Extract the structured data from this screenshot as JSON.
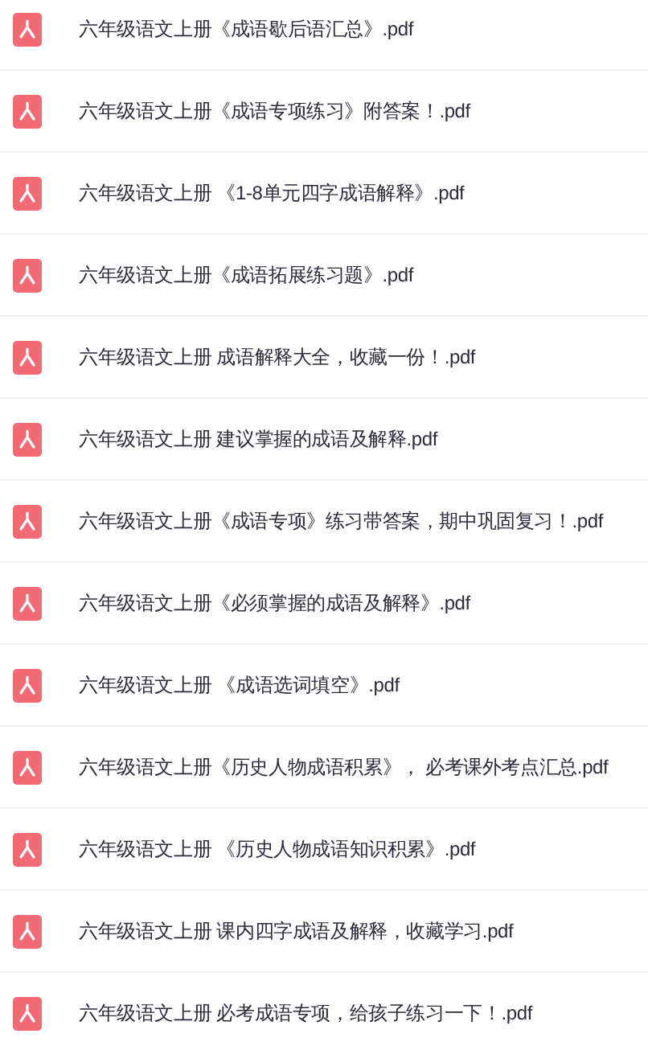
{
  "files": [
    {
      "name": "六年级语文上册《成语歇后语汇总》.pdf"
    },
    {
      "name": "六年级语文上册《成语专项练习》附答案！.pdf"
    },
    {
      "name": "六年级语文上册 《1-8单元四字成语解释》.pdf"
    },
    {
      "name": "六年级语文上册《成语拓展练习题》.pdf"
    },
    {
      "name": "六年级语文上册 成语解释大全，收藏一份！.pdf"
    },
    {
      "name": "六年级语文上册 建议掌握的成语及解释.pdf"
    },
    {
      "name": "六年级语文上册《成语专项》练习带答案，期中巩固复习！.pdf"
    },
    {
      "name": "六年级语文上册《必须掌握的成语及解释》.pdf"
    },
    {
      "name": "六年级语文上册 《成语选词填空》.pdf"
    },
    {
      "name": "六年级语文上册《历史人物成语积累》， 必考课外考点汇总.pdf"
    },
    {
      "name": "六年级语文上册 《历史人物成语知识积累》.pdf"
    },
    {
      "name": "六年级语文上册 课内四字成语及解释，收藏学习.pdf"
    },
    {
      "name": "六年级语文上册 必考成语专项，给孩子练习一下！.pdf"
    }
  ]
}
